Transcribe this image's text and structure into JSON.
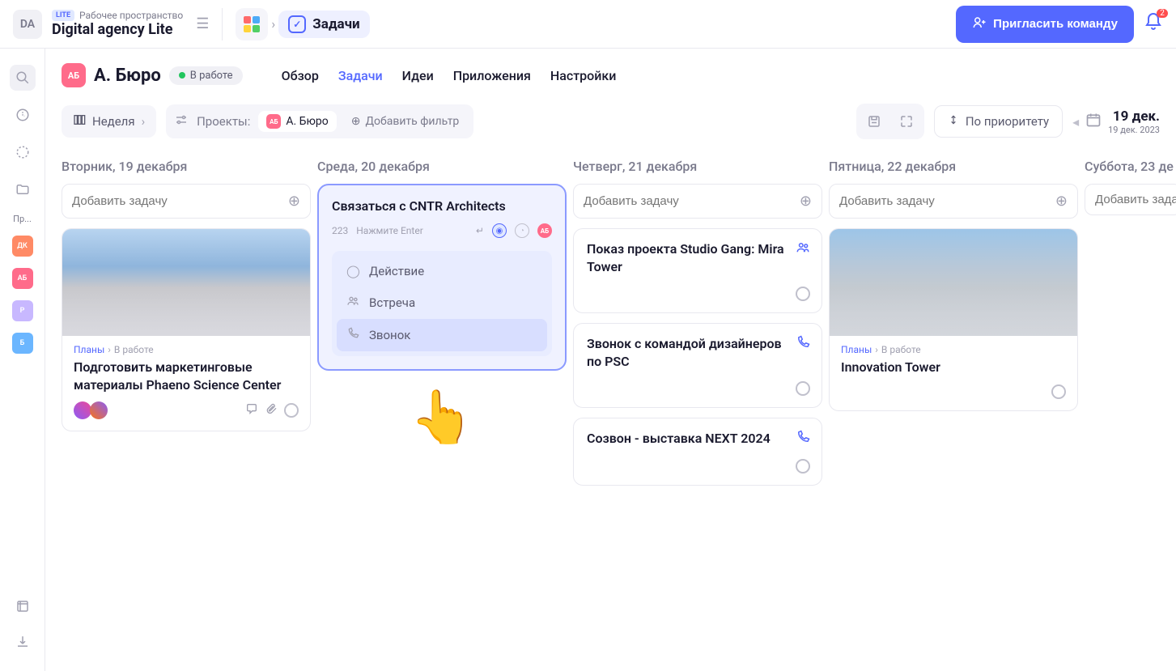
{
  "workspace": {
    "avatar_text": "DA",
    "lite_badge": "LITE",
    "label": "Рабочее пространство",
    "name": "Digital agency Lite"
  },
  "nav": {
    "tasks_label": "Задачи"
  },
  "invite_button": "Пригласить команду",
  "bell_count": "2",
  "project": {
    "avatar": "АБ",
    "name": "А. Бюро",
    "status": "В работе",
    "tabs": {
      "overview": "Обзор",
      "tasks": "Задачи",
      "ideas": "Идеи",
      "apps": "Приложения",
      "settings": "Настройки"
    }
  },
  "toolbar": {
    "view_label": "Неделя",
    "projects_label": "Проекты:",
    "project_filter_avatar": "АБ",
    "project_filter_name": "А. Бюро",
    "add_filter": "Добавить фильтр",
    "sort_label": "По приоритету",
    "date_main": "19 дек.",
    "date_sub": "19 дек. 2023"
  },
  "sidebar": {
    "label": "Пр...",
    "items": [
      {
        "text": "ДК",
        "color": "#ff8a65"
      },
      {
        "text": "АБ",
        "color": "#ff6b8a"
      },
      {
        "text": "Р",
        "color": "#c8b8ff"
      },
      {
        "text": "Б",
        "color": "#6bb6ff"
      }
    ]
  },
  "columns": [
    {
      "header": "Вторник, 19 декабря"
    },
    {
      "header": "Среда, 20 декабря"
    },
    {
      "header": "Четверг, 21 декабря"
    },
    {
      "header": "Пятница, 22 декабря"
    },
    {
      "header": "Суббота, 23 де"
    }
  ],
  "add_task_placeholder": "Добавить задачу",
  "card_tue": {
    "crumb_plan": "Планы",
    "crumb_status": "В работе",
    "title": "Подготовить маркетинговые материалы Phaeno Science Center"
  },
  "active_task": {
    "title": "Связаться с CNTR Architects",
    "number": "223",
    "hint": "Нажмите Enter",
    "avatar": "АБ",
    "actions": {
      "action": "Действие",
      "meeting": "Встреча",
      "call": "Звонок"
    }
  },
  "tasks_thu": [
    {
      "title": "Показ проекта Studio Gang: Mira Tower",
      "icon": "people"
    },
    {
      "title": "Звонок с командой дизайнеров по PSC",
      "icon": "phone"
    },
    {
      "title": "Созвон - выставка NEXT 2024",
      "icon": "phone"
    }
  ],
  "card_fri": {
    "crumb_plan": "Планы",
    "crumb_status": "В работе",
    "title": "Innovation Tower"
  }
}
